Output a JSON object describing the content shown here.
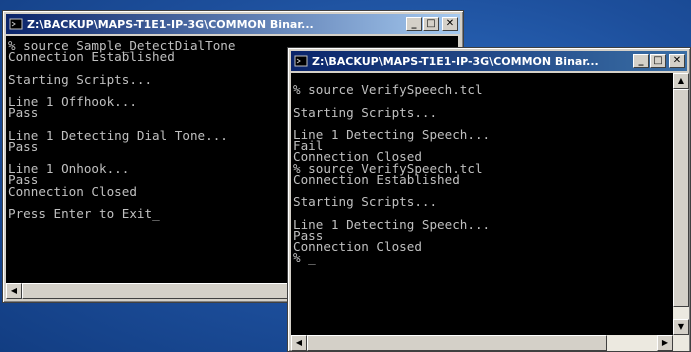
{
  "window1": {
    "title": "Z:\\BACKUP\\MAPS-T1E1-IP-3G\\COMMON Binar...",
    "lines": [
      "% source Sample_DetectDialTone",
      "Connection Established",
      "",
      "Starting Scripts...",
      "",
      "Line 1 Offhook...",
      "Pass",
      "",
      "Line 1 Detecting Dial Tone...",
      "Pass",
      "",
      "Line 1 Onhook...",
      "Pass",
      "Connection Closed",
      "",
      "Press Enter to Exit"
    ],
    "cursor": "_"
  },
  "window2": {
    "title": "Z:\\BACKUP\\MAPS-T1E1-IP-3G\\COMMON Binar...",
    "lines": [
      "",
      "% source VerifySpeech.tcl",
      "",
      "Starting Scripts...",
      "",
      "Line 1 Detecting Speech...",
      "Fail",
      "Connection Closed",
      "% source VerifySpeech.tcl",
      "Connection Established",
      "",
      "Starting Scripts...",
      "",
      "Line 1 Detecting Speech...",
      "Pass",
      "Connection Closed",
      "% "
    ],
    "cursor": "_"
  },
  "icons": {
    "window_icon": "console-icon",
    "minimize": "minimize-icon",
    "maximize": "maximize-icon",
    "close": "close-icon",
    "scroll_up": "scroll-up-arrow-icon",
    "scroll_down": "scroll-down-arrow-icon",
    "scroll_left": "scroll-left-arrow-icon",
    "scroll_right": "scroll-right-arrow-icon"
  },
  "glyphs": {
    "minimize": "_",
    "maximize": "□",
    "close": "✕",
    "up": "▲",
    "down": "▼",
    "left": "◀",
    "right": "▶"
  }
}
